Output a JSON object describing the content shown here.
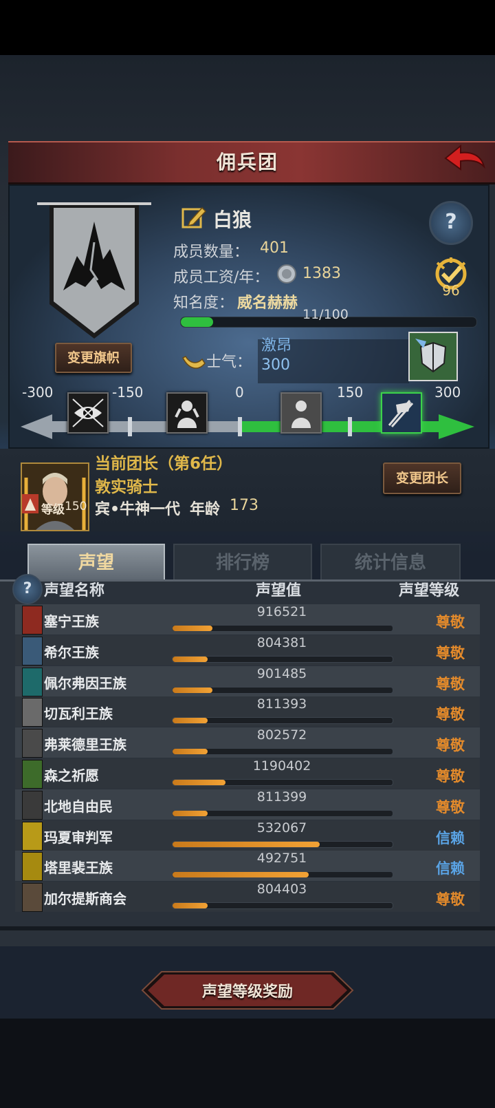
{
  "header": {
    "title": "佣兵团"
  },
  "guild": {
    "name": "白狼",
    "members_label": "成员数量：",
    "members_value": "401",
    "wage_label": "成员工资/年：",
    "wage_value": "1383",
    "fame_label": "知名度：",
    "fame_value": "威名赫赫",
    "fame_progress_text": "11/100",
    "fame_progress": 0.11,
    "rank_value": "96",
    "change_banner_label": "变更旗帜"
  },
  "morale": {
    "label": "士气：",
    "state": "激昂",
    "value": "300",
    "value_num": 300,
    "ticks": [
      "-300",
      "-150",
      "0",
      "150",
      "300"
    ]
  },
  "leader": {
    "title": "当前团长（第6任）",
    "name": "敦实骑士",
    "race": "宾•牛神一代",
    "age_label": "年龄",
    "age_value": "173",
    "level_label": "等级",
    "level_value": "150",
    "change_leader_label": "变更团长"
  },
  "tabs": [
    "声望",
    "排行榜",
    "统计信息"
  ],
  "table": {
    "headers": {
      "name": "声望名称",
      "value": "声望值",
      "level": "声望等级"
    },
    "rows": [
      {
        "name": "塞宁王族",
        "value": "916521",
        "progress": 0.18,
        "level": "尊敬",
        "level_color": "#e38a2b",
        "emblem_color": "#8e2a20"
      },
      {
        "name": "希尔王族",
        "value": "804381",
        "progress": 0.16,
        "level": "尊敬",
        "level_color": "#e38a2b",
        "emblem_color": "#3a5a78"
      },
      {
        "name": "佩尔弗因王族",
        "value": "901485",
        "progress": 0.18,
        "level": "尊敬",
        "level_color": "#e38a2b",
        "emblem_color": "#1e6a6a"
      },
      {
        "name": "切瓦利王族",
        "value": "811393",
        "progress": 0.16,
        "level": "尊敬",
        "level_color": "#e38a2b",
        "emblem_color": "#6a6a6a"
      },
      {
        "name": "弗莱德里王族",
        "value": "802572",
        "progress": 0.16,
        "level": "尊敬",
        "level_color": "#e38a2b",
        "emblem_color": "#4a4a4a"
      },
      {
        "name": "森之祈愿",
        "value": "1190402",
        "progress": 0.24,
        "level": "尊敬",
        "level_color": "#e38a2b",
        "emblem_color": "#3d6b2a"
      },
      {
        "name": "北地自由民",
        "value": "811399",
        "progress": 0.16,
        "level": "尊敬",
        "level_color": "#e38a2b",
        "emblem_color": "#3a3a3a"
      },
      {
        "name": "玛夏审判军",
        "value": "532067",
        "progress": 0.67,
        "level": "信赖",
        "level_color": "#5aa4e6",
        "emblem_color": "#b89a18"
      },
      {
        "name": "塔里裴王族",
        "value": "492751",
        "progress": 0.62,
        "level": "信赖",
        "level_color": "#5aa4e6",
        "emblem_color": "#a68a10"
      },
      {
        "name": "加尔提斯商会",
        "value": "804403",
        "progress": 0.16,
        "level": "尊敬",
        "level_color": "#e38a2b",
        "emblem_color": "#5a4a3a"
      }
    ]
  },
  "footer": {
    "reward_button_label": "声望等级奖励"
  },
  "colors": {
    "accent_orange": "#f2a235",
    "trust_blue": "#5aa4e6",
    "header_red": "#7a2f2e",
    "morale_green": "#2fbf3f"
  }
}
